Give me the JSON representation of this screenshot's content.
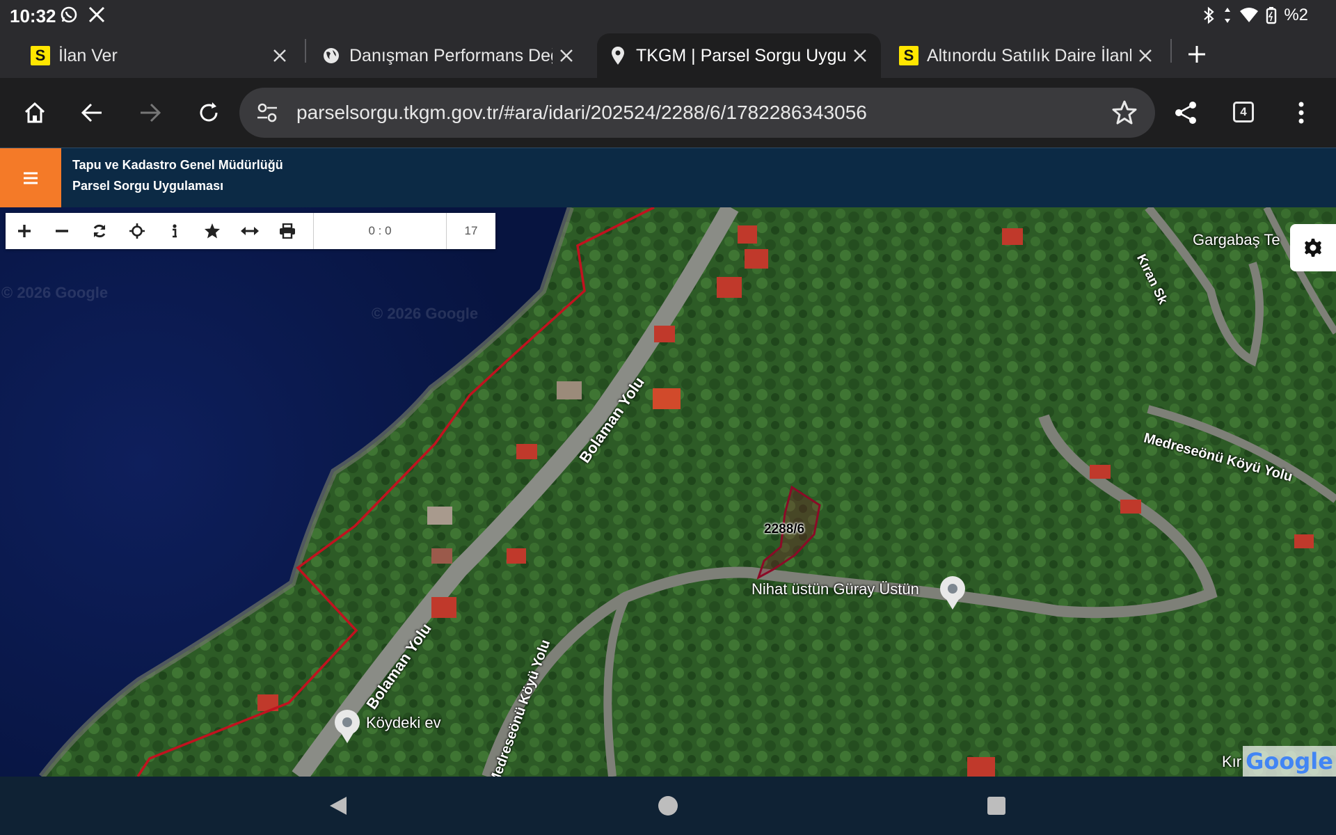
{
  "status": {
    "time": "10:32",
    "battery": "%2",
    "icons": [
      "whatsapp-icon",
      "x-icon",
      "bluetooth-icon",
      "data-arrows-icon",
      "wifi-icon",
      "battery-icon"
    ]
  },
  "tabs": [
    {
      "title": "İlan Ver",
      "favicon": "S",
      "active": false
    },
    {
      "title": "Danışman Performans Değerlendirme",
      "favicon": "globe-icon",
      "active": false
    },
    {
      "title": "TKGM | Parsel Sorgu Uygulaması",
      "favicon": "pin-icon",
      "active": true
    },
    {
      "title": "Altınordu Satılık Daire İlanları",
      "favicon": "S",
      "active": false
    }
  ],
  "toolbar": {
    "url": "parselsorgu.tkgm.gov.tr/#ara/idari/202524/2288/6/1782286343056",
    "tab_count": "4"
  },
  "site": {
    "title_line1": "Tapu ve Kadastro Genel Müdürlüğü",
    "title_line2": "Parsel Sorgu Uygulaması"
  },
  "map_tools": {
    "coordinates": "0 : 0",
    "zoom": "17"
  },
  "map": {
    "parcel_label": "2288/6",
    "place_1": "Nihat üstün Güray Üstün",
    "place_2": "Köydeki ev",
    "area_label": "Gargabaş Te",
    "street_1": "Kıran Sk",
    "road_1": "Bolaman Yolu",
    "road_2": "Bolaman Yolu",
    "road_3": "Medreseönü Köyü Yolu",
    "road_4": "Medreseönü Köyü Yolu",
    "partial_label": "Kır",
    "watermark": "© 2026 Google",
    "logo": "Google"
  }
}
